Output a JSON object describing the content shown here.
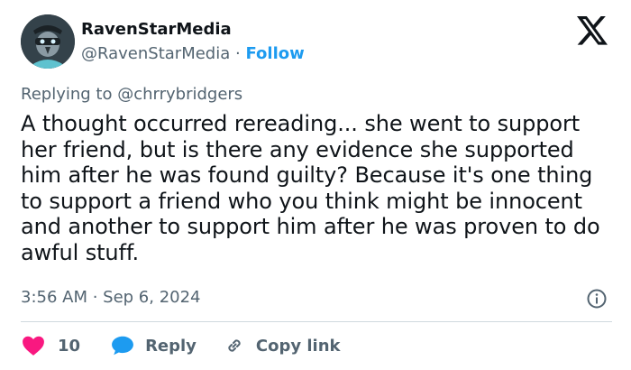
{
  "author": {
    "display_name": "RavenStarMedia",
    "handle": "@RavenStarMedia",
    "separator": "·",
    "follow_label": "Follow"
  },
  "tweet": {
    "reply_to": "Replying to @chrrybridgers",
    "text": "A thought occurred rereading... she went to support her friend, but is there any evidence she supported him after he was found guilty? Because it's one thing to support a friend who you think might be innocent and another to support him after he was proven to do awful stuff.",
    "timestamp": "3:56 AM · Sep 6, 2024"
  },
  "actions": {
    "like_count": "10",
    "reply_label": "Reply",
    "copy_link_label": "Copy link"
  },
  "icons": {
    "avatar": "raven-mask-avatar",
    "logo": "x-logo-icon",
    "info": "info-icon",
    "like": "heart-icon",
    "reply": "speech-bubble-icon",
    "copy": "link-icon"
  },
  "colors": {
    "accent": "#1d9bf0",
    "like": "#f91880",
    "text": "#0f1419",
    "muted": "#536471",
    "divider": "#cfd9de"
  }
}
